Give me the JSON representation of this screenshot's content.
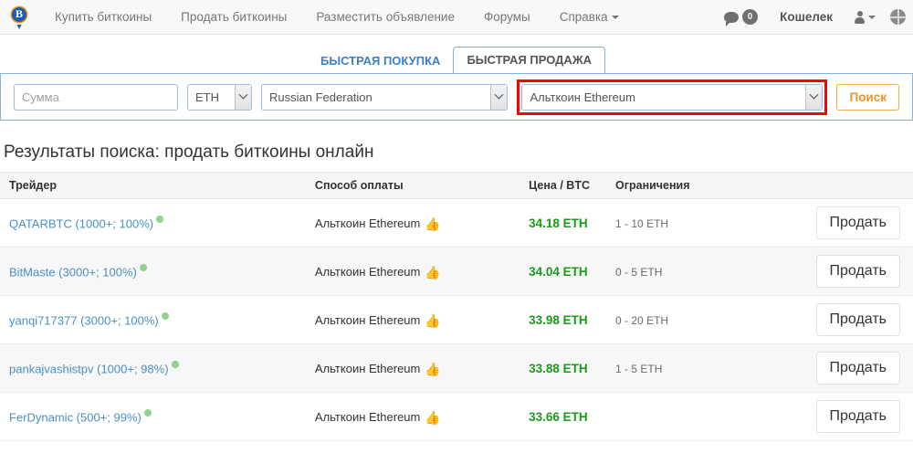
{
  "navbar": {
    "logo_icon": "bitcoin-map-pin-logo",
    "links": [
      {
        "label": "Купить биткоины",
        "name": "nav-buy-bitcoins"
      },
      {
        "label": "Продать биткоины",
        "name": "nav-sell-bitcoins"
      },
      {
        "label": "Разместить объявление",
        "name": "nav-post-ad"
      },
      {
        "label": "Форумы",
        "name": "nav-forums"
      },
      {
        "label": "Справка",
        "name": "nav-help",
        "has_caret": true
      }
    ],
    "messages": {
      "icon": "chat-bubble-icon",
      "count": "0"
    },
    "wallet_label": "Кошелек",
    "user_icon": "user-account-icon",
    "globe_icon": "globe-icon"
  },
  "tabs": [
    {
      "label": "БЫСТРАЯ ПОКУПКА",
      "active": false
    },
    {
      "label": "БЫСТРАЯ ПРОДАЖА",
      "active": true
    }
  ],
  "search_form": {
    "amount_placeholder": "Сумма",
    "amount_value": "",
    "currency_value": "ETH",
    "country_value": "Russian Federation",
    "method_value": "Альткоин Ethereum",
    "method_highlighted": true,
    "highlight_color": "#ff0000",
    "search_button": "Поиск",
    "search_button_color": "#f0932b"
  },
  "results": {
    "title": "Результаты поиска: продать биткоины онлайн",
    "columns": [
      "Трейдер",
      "Способ оплаты",
      "Цена / BTC",
      "Ограничения",
      ""
    ],
    "action_label": "Продать",
    "rows": [
      {
        "trader": "QATARBTC (1000+; 100%)",
        "status_icon": "online-dot",
        "method": "Альткоин Ethereum",
        "method_icon": "thumbs-up-icon",
        "price": "34.18 ETH",
        "limits": "1 - 10 ETH",
        "action": "Продать"
      },
      {
        "trader": "BitMaste (3000+; 100%)",
        "status_icon": "online-dot",
        "method": "Альткоин Ethereum",
        "method_icon": "thumbs-up-icon",
        "price": "34.04 ETH",
        "limits": "0 - 5 ETH",
        "action": "Продать"
      },
      {
        "trader": "yanqi717377 (3000+; 100%)",
        "status_icon": "online-dot",
        "method": "Альткоин Ethereum",
        "method_icon": "thumbs-up-icon",
        "price": "33.98 ETH",
        "limits": "0 - 20 ETH",
        "action": "Продать"
      },
      {
        "trader": "pankajvashistpv (1000+; 98%)",
        "status_icon": "online-dot",
        "method": "Альткоин Ethereum",
        "method_icon": "thumbs-up-icon",
        "price": "33.88 ETH",
        "limits": "1 - 5 ETH",
        "action": "Продать"
      },
      {
        "trader": "FerDynamic (500+; 99%)",
        "status_icon": "online-dot",
        "method": "Альткоин Ethereum",
        "method_icon": "thumbs-up-icon",
        "price": "33.66 ETH",
        "limits": "",
        "action": "Продать"
      }
    ]
  }
}
